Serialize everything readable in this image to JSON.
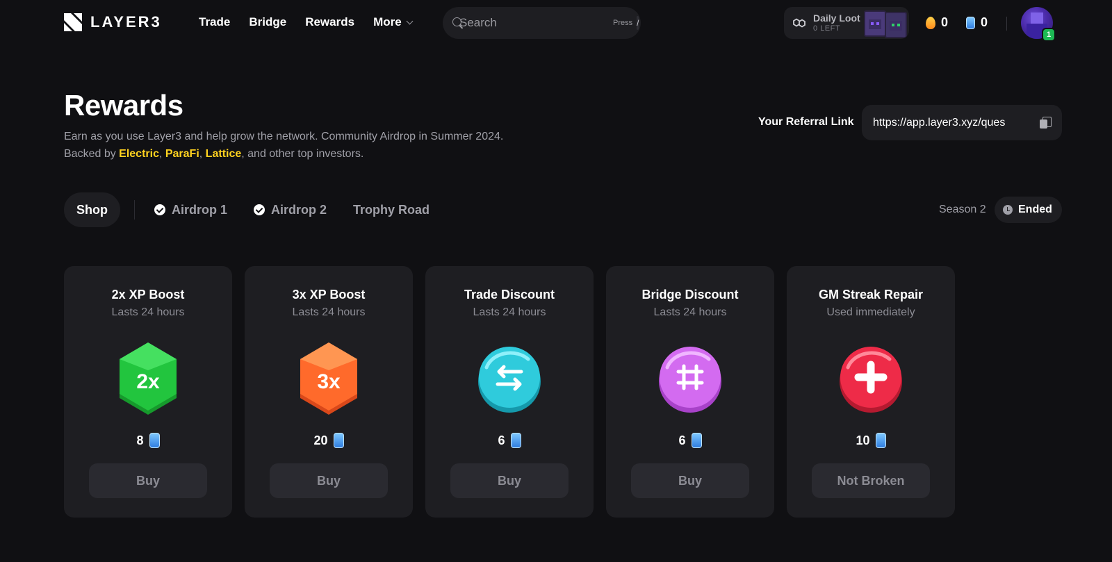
{
  "brand": {
    "name": "LAYER3"
  },
  "nav": {
    "links": [
      {
        "label": "Trade"
      },
      {
        "label": "Bridge"
      },
      {
        "label": "Rewards"
      },
      {
        "label": "More"
      }
    ],
    "search": {
      "placeholder": "Search",
      "press_label": "Press",
      "shortcut": "/"
    },
    "daily_loot": {
      "title": "Daily Loot",
      "remaining": "0 LEFT"
    },
    "streak_count": "0",
    "gem_count": "0",
    "user": {
      "level": "1"
    }
  },
  "header": {
    "title": "Rewards",
    "description_prefix": "Earn as you use Layer3 and help grow the network. Community Airdrop in Summer 2024. Backed by ",
    "investors": [
      "Electric",
      "ParaFi",
      "Lattice"
    ],
    "sep1": ", ",
    "sep2": ", ",
    "description_suffix": ", and other top investors.",
    "referral_label": "Your Referral Link",
    "referral_url": "https://app.layer3.xyz/ques"
  },
  "tabs": [
    {
      "label": "Shop",
      "active": true,
      "checked": false
    },
    {
      "label": "Airdrop 1",
      "active": false,
      "checked": true
    },
    {
      "label": "Airdrop 2",
      "active": false,
      "checked": true
    },
    {
      "label": "Trophy Road",
      "active": false,
      "checked": false
    }
  ],
  "season": {
    "label": "Season 2",
    "status": "Ended"
  },
  "shop_items": [
    {
      "title": "2x XP Boost",
      "subtitle": "Lasts 24 hours",
      "price": "8",
      "button": "Buy",
      "art": "2x",
      "icon": "green-hexagon-2x-icon",
      "color": "#22c53e"
    },
    {
      "title": "3x XP Boost",
      "subtitle": "Lasts 24 hours",
      "price": "20",
      "button": "Buy",
      "art": "3x",
      "icon": "orange-hexagon-3x-icon",
      "color": "#ff6a2b"
    },
    {
      "title": "Trade Discount",
      "subtitle": "Lasts 24 hours",
      "price": "6",
      "button": "Buy",
      "art": "",
      "icon": "swap-arrows-icon",
      "color": "#2fcbdc"
    },
    {
      "title": "Bridge Discount",
      "subtitle": "Lasts 24 hours",
      "price": "6",
      "button": "Buy",
      "art": "",
      "icon": "bridge-icon",
      "color": "#d36bf0"
    },
    {
      "title": "GM Streak Repair",
      "subtitle": "Used immediately",
      "price": "10",
      "button": "Not Broken",
      "art": "",
      "icon": "plus-cross-icon",
      "color": "#ee2b48"
    }
  ]
}
